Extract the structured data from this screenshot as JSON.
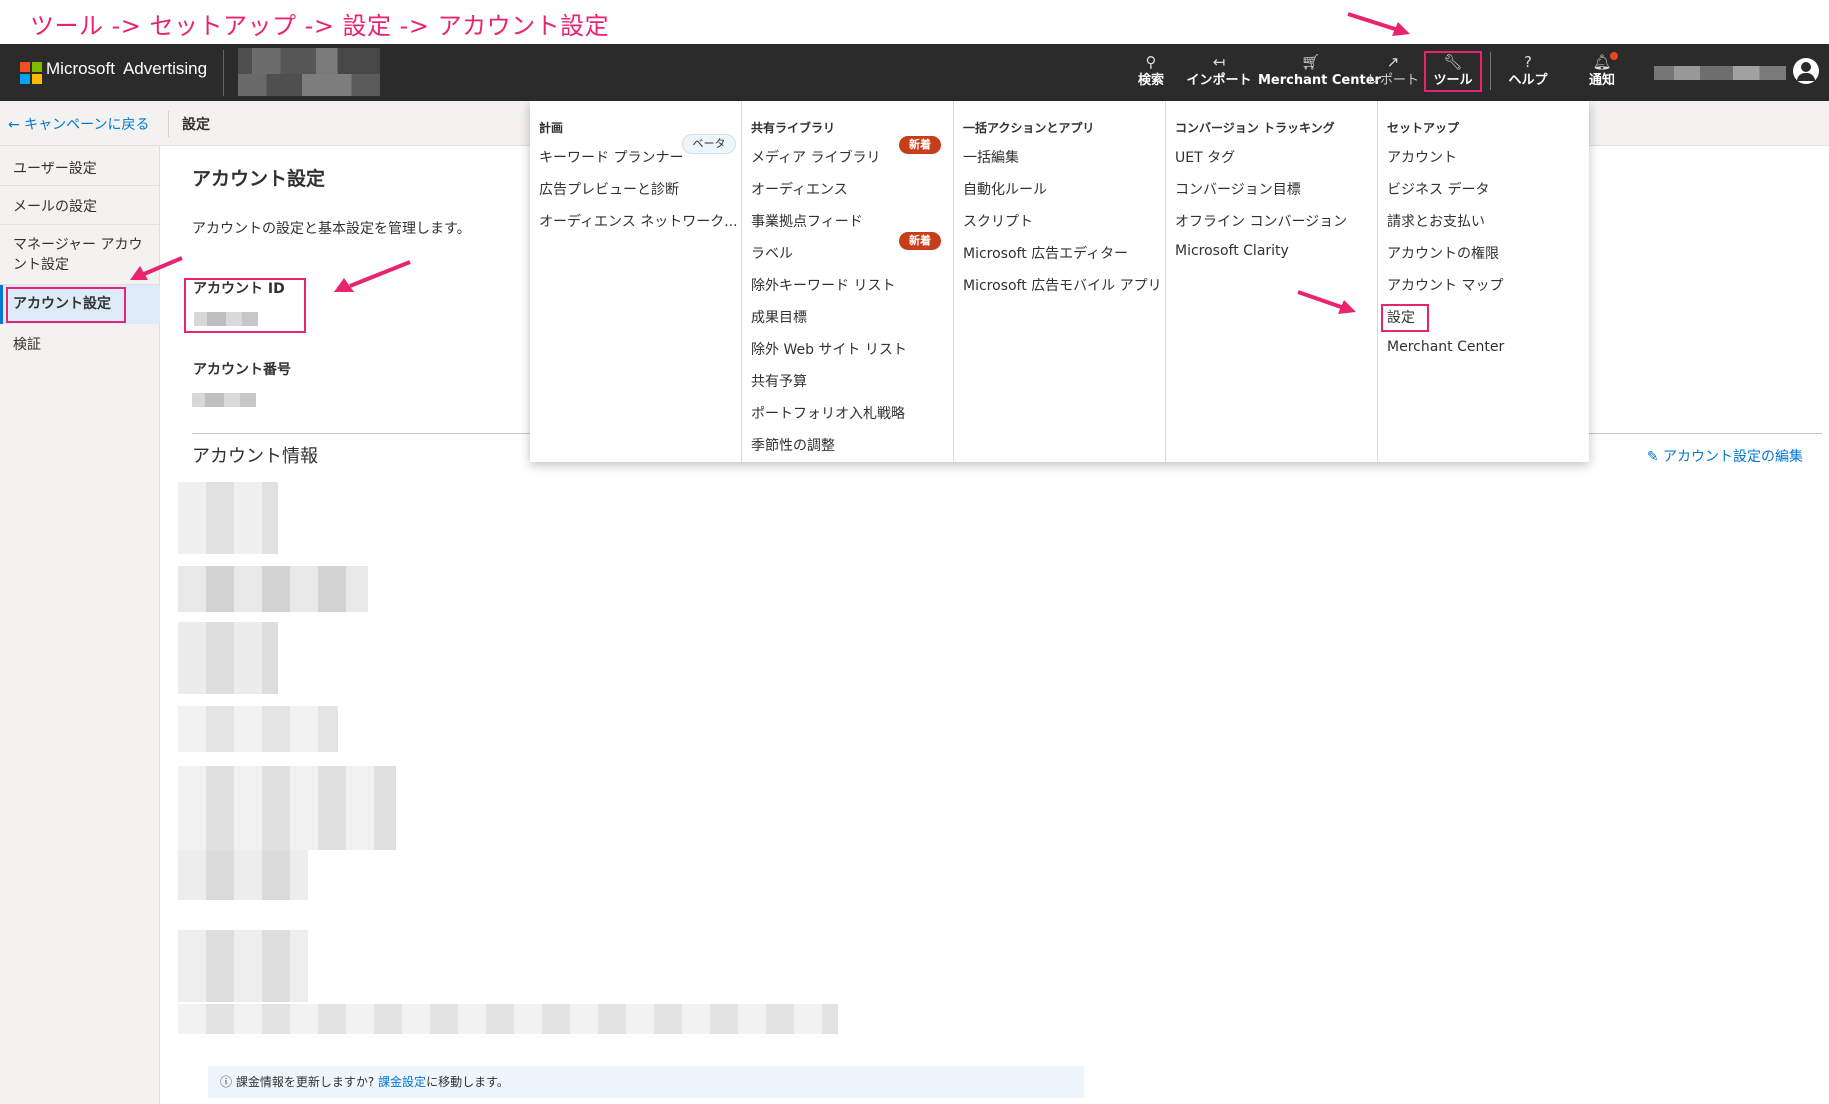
{
  "annotation": {
    "caption": "ツール -> セットアップ -> 設定 -> アカウント設定",
    "accent_color": "#e8246f"
  },
  "topbar": {
    "brand": "Microsoft",
    "product": "Advertising",
    "items": [
      {
        "label": "検索",
        "icon": "search-icon"
      },
      {
        "label": "インポート",
        "icon": "import-icon"
      },
      {
        "label": "Merchant Center",
        "icon": "cart-icon"
      },
      {
        "label": "レポート",
        "icon": "chart-icon"
      },
      {
        "label": "ツール",
        "icon": "wrench-icon"
      },
      {
        "label": "ヘルプ",
        "icon": "help-icon"
      },
      {
        "label": "通知",
        "icon": "bell-icon"
      }
    ],
    "bg_color": "#2b2b2b"
  },
  "subbar": {
    "back_label": "← キャンペーンに戻る",
    "title": "設定"
  },
  "sidebar": {
    "items": [
      {
        "label": "ユーザー設定"
      },
      {
        "label": "メールの設定"
      },
      {
        "label": "マネージャー アカウント設定"
      },
      {
        "label": "アカウント設定"
      },
      {
        "label": "検証"
      }
    ]
  },
  "main": {
    "title": "アカウント設定",
    "description": "アカウントの設定と基本設定を管理します。",
    "account_id_label": "アカウント ID",
    "account_number_label": "アカウント番号",
    "section_title": "アカウント情報",
    "edit_link": "アカウント設定の編集",
    "info_bar": {
      "prefix": "課金情報を更新しますか?",
      "link": "課金設定",
      "suffix": "に移動します。"
    }
  },
  "menu": {
    "columns": [
      {
        "heading": "計画",
        "items": [
          "キーワード プランナー",
          "広告プレビューと診断",
          "オーディエンス ネットワーク..."
        ],
        "beta_badge": "ベータ"
      },
      {
        "heading": "共有ライブラリ",
        "items": [
          "メディア ライブラリ",
          "オーディエンス",
          "事業拠点フィード",
          "ラベル",
          "除外キーワード リスト",
          "成果目標",
          "除外 Web サイト リスト",
          "共有予算",
          "ポートフォリオ入札戦略",
          "季節性の調整"
        ],
        "new_badge": "新着"
      },
      {
        "heading": "一括アクションとアプリ",
        "items": [
          "一括編集",
          "自動化ルール",
          "スクリプト",
          "Microsoft 広告エディター",
          "Microsoft 広告モバイル アプリ"
        ]
      },
      {
        "heading": "コンバージョン トラッキング",
        "items": [
          "UET タグ",
          "コンバージョン目標",
          "オフライン コンバージョン",
          "Microsoft Clarity"
        ]
      },
      {
        "heading": "セットアップ",
        "items": [
          "アカウント",
          "ビジネス データ",
          "請求とお支払い",
          "アカウントの権限",
          "アカウント マップ",
          "設定",
          "Merchant Center"
        ]
      }
    ]
  }
}
